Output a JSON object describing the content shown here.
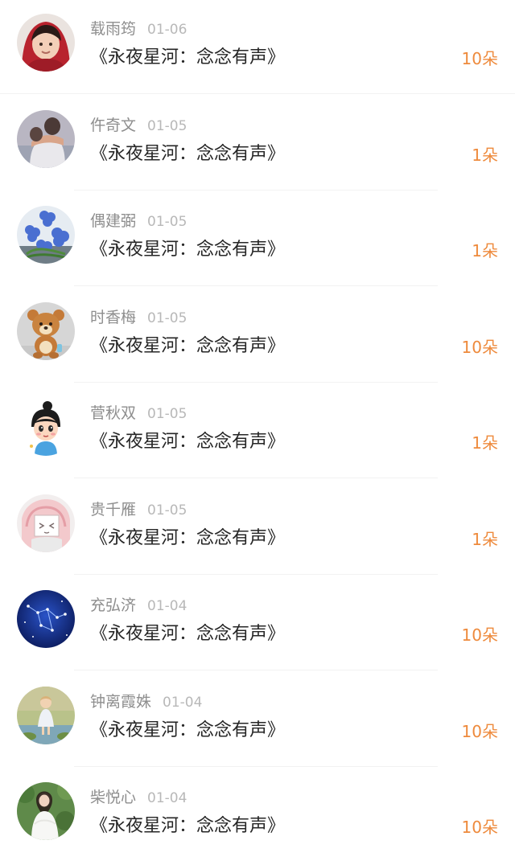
{
  "list": {
    "items": [
      {
        "name": "载雨筠",
        "date": "01-06",
        "title": "《永夜星河：念念有声》",
        "gift": "10朵",
        "avatar_icon": "avatar-child-red-hood-icon"
      },
      {
        "name": "仵奇文",
        "date": "01-05",
        "title": "《永夜星河：念念有声》",
        "gift": "1朵",
        "avatar_icon": "avatar-couple-hug-icon"
      },
      {
        "name": "偶建弼",
        "date": "01-05",
        "title": "《永夜星河：念念有声》",
        "gift": "1朵",
        "avatar_icon": "avatar-blue-flowers-icon"
      },
      {
        "name": "时香梅",
        "date": "01-05",
        "title": "《永夜星河：念念有声》",
        "gift": "10朵",
        "avatar_icon": "avatar-teddy-bear-icon"
      },
      {
        "name": "菅秋双",
        "date": "01-05",
        "title": "《永夜星河：念念有声》",
        "gift": "1朵",
        "avatar_icon": "avatar-cartoon-girl-icon"
      },
      {
        "name": "贵千雁",
        "date": "01-05",
        "title": "《永夜星河：念念有声》",
        "gift": "1朵",
        "avatar_icon": "avatar-anime-sketch-icon"
      },
      {
        "name": "充弘济",
        "date": "01-04",
        "title": "《永夜星河：念念有声》",
        "gift": "10朵",
        "avatar_icon": "avatar-constellation-icon"
      },
      {
        "name": "钟离霞姝",
        "date": "01-04",
        "title": "《永夜星河：念念有声》",
        "gift": "10朵",
        "avatar_icon": "avatar-child-outdoor-icon"
      },
      {
        "name": "柴悦心",
        "date": "01-04",
        "title": "《永夜星河：念念有声》",
        "gift": "10朵",
        "avatar_icon": "avatar-woman-greenery-icon"
      }
    ]
  },
  "colors": {
    "name": "#8e8e8e",
    "date": "#b8b8b8",
    "title": "#262626",
    "gift": "#ee8a3c",
    "divider": "#f2f2f2"
  }
}
